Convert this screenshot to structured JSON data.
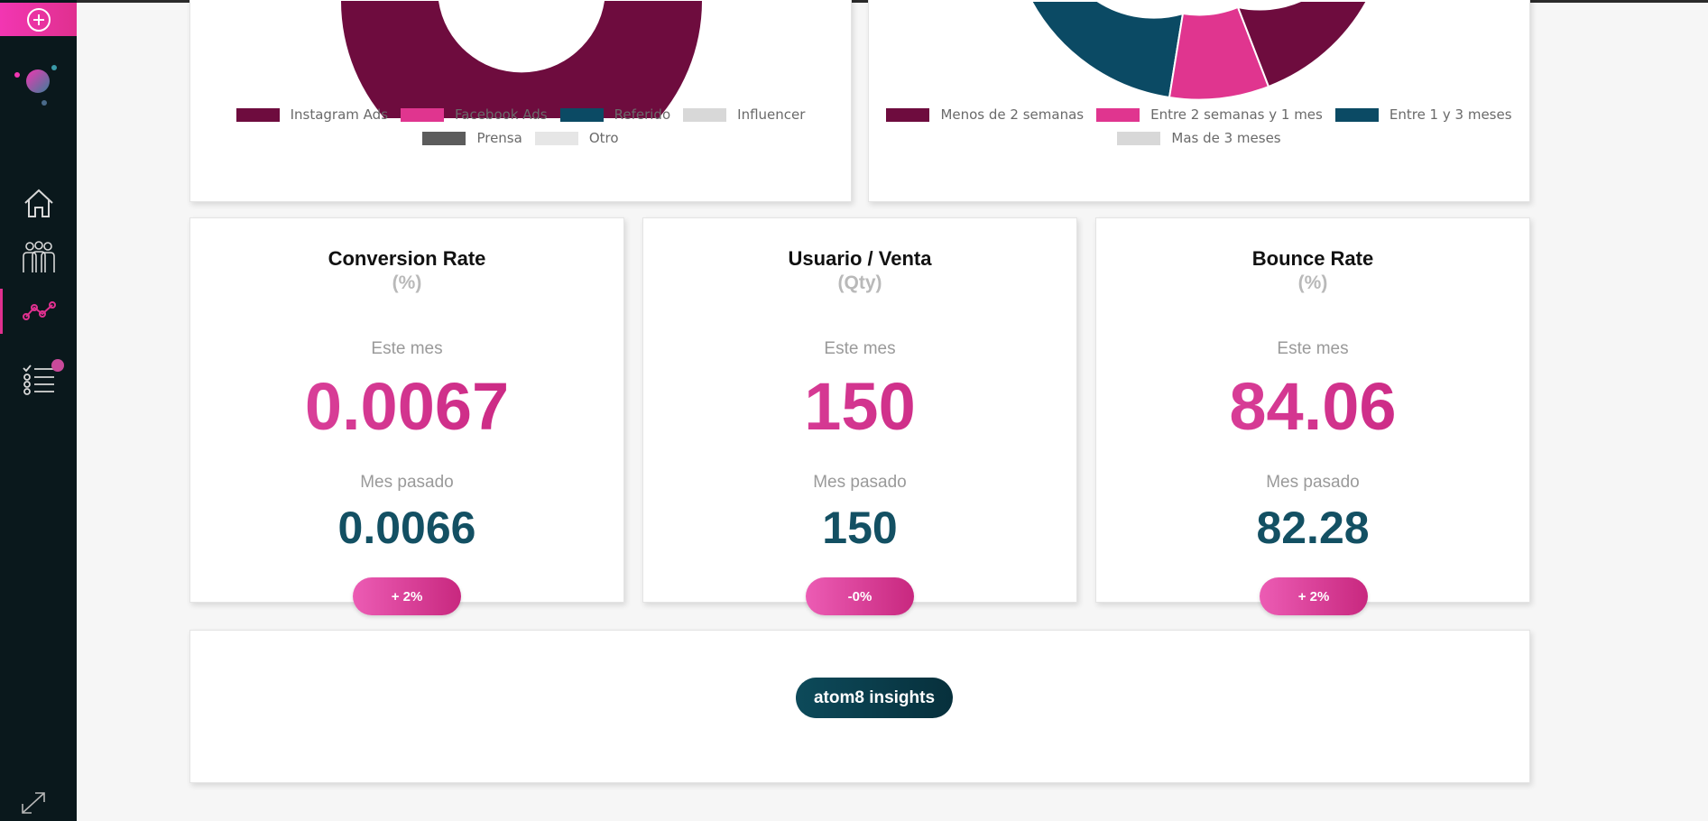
{
  "colors": {
    "accent_pink": "#e0308f",
    "dark_teal": "#135063",
    "sidebar_bg": "#0a181c",
    "instagram": "#6e0c3e",
    "facebook": "#e0358f",
    "referido": "#0b4a64",
    "influencer": "#d8d8d8",
    "prensa": "#5c5c5c",
    "otro": "#e6e6e6"
  },
  "sidebar": {
    "items": [
      {
        "icon": "home-icon"
      },
      {
        "icon": "team-icon"
      },
      {
        "icon": "analytics-icon",
        "active": true
      },
      {
        "icon": "tasks-icon",
        "badge": true
      }
    ]
  },
  "chart_left": {
    "legend": [
      {
        "label": "Instagram Ads",
        "color": "#6e0c3e"
      },
      {
        "label": "Facebook Ads",
        "color": "#e0358f"
      },
      {
        "label": "Referido",
        "color": "#0b4a64"
      },
      {
        "label": "Influencer",
        "color": "#d8d8d8"
      },
      {
        "label": "Prensa",
        "color": "#5c5c5c"
      },
      {
        "label": "Otro",
        "color": "#e6e6e6"
      }
    ]
  },
  "chart_right": {
    "legend": [
      {
        "label": "Menos de 2 semanas",
        "color": "#6e0c3e"
      },
      {
        "label": "Entre 2 semanas y 1 mes",
        "color": "#e0358f"
      },
      {
        "label": "Entre 1 y 3 meses",
        "color": "#0b4a64"
      },
      {
        "label": "Mas de 3 meses",
        "color": "#d8d8d8"
      }
    ]
  },
  "metrics": [
    {
      "title": "Conversion Rate",
      "unit": "(%)",
      "this_label": "Este mes",
      "this_value": "0.0067",
      "last_label": "Mes pasado",
      "last_value": "0.0066",
      "change": "+ 2%"
    },
    {
      "title": "Usuario / Venta",
      "unit": "(Qty)",
      "this_label": "Este mes",
      "this_value": "150",
      "last_label": "Mes pasado",
      "last_value": "150",
      "change": "-0%"
    },
    {
      "title": "Bounce Rate",
      "unit": "(%)",
      "this_label": "Este mes",
      "this_value": "84.06",
      "last_label": "Mes pasado",
      "last_value": "82.28",
      "change": "+ 2%"
    }
  ],
  "insights": {
    "button_label": "atom8 insights"
  }
}
